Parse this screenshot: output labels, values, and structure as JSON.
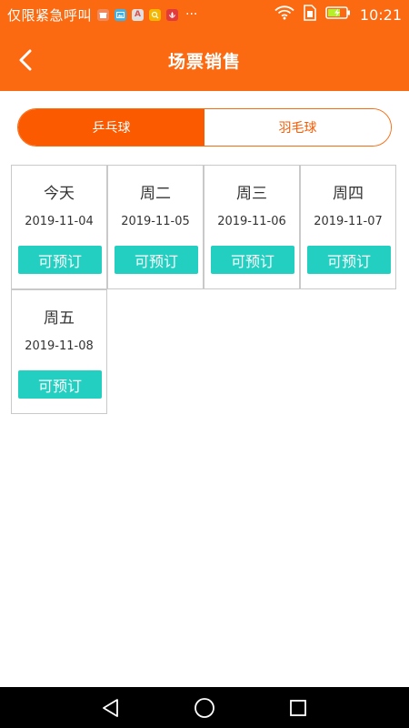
{
  "status_bar": {
    "carrier": "仅限紧急呼叫",
    "more": "···",
    "time": "10:21",
    "notification_icons": [
      {
        "name": "gift-icon",
        "color": "#f08a5d",
        "glyph": ""
      },
      {
        "name": "gallery-icon",
        "color": "#3fb3e8",
        "glyph": ""
      },
      {
        "name": "font-icon",
        "color": "#e0e0e0",
        "glyph": "A"
      },
      {
        "name": "search-app-icon",
        "color": "#f5b700",
        "glyph": ""
      },
      {
        "name": "huawei-icon",
        "color": "#e23b3b",
        "glyph": ""
      }
    ]
  },
  "app_bar": {
    "title": "场票销售"
  },
  "tabs": [
    {
      "label": "乒乓球",
      "active": true
    },
    {
      "label": "羽毛球",
      "active": false
    }
  ],
  "dates": [
    {
      "day": "今天",
      "date": "2019-11-04",
      "action": "可预订"
    },
    {
      "day": "周二",
      "date": "2019-11-05",
      "action": "可预订"
    },
    {
      "day": "周三",
      "date": "2019-11-06",
      "action": "可预订"
    },
    {
      "day": "周四",
      "date": "2019-11-07",
      "action": "可预订"
    },
    {
      "day": "周五",
      "date": "2019-11-08",
      "action": "可预订"
    }
  ],
  "colors": {
    "brand": "#fb6a10",
    "tab_active": "#fb5a00",
    "book_button": "#22cfc0",
    "grid_border": "#c9c9c9"
  }
}
